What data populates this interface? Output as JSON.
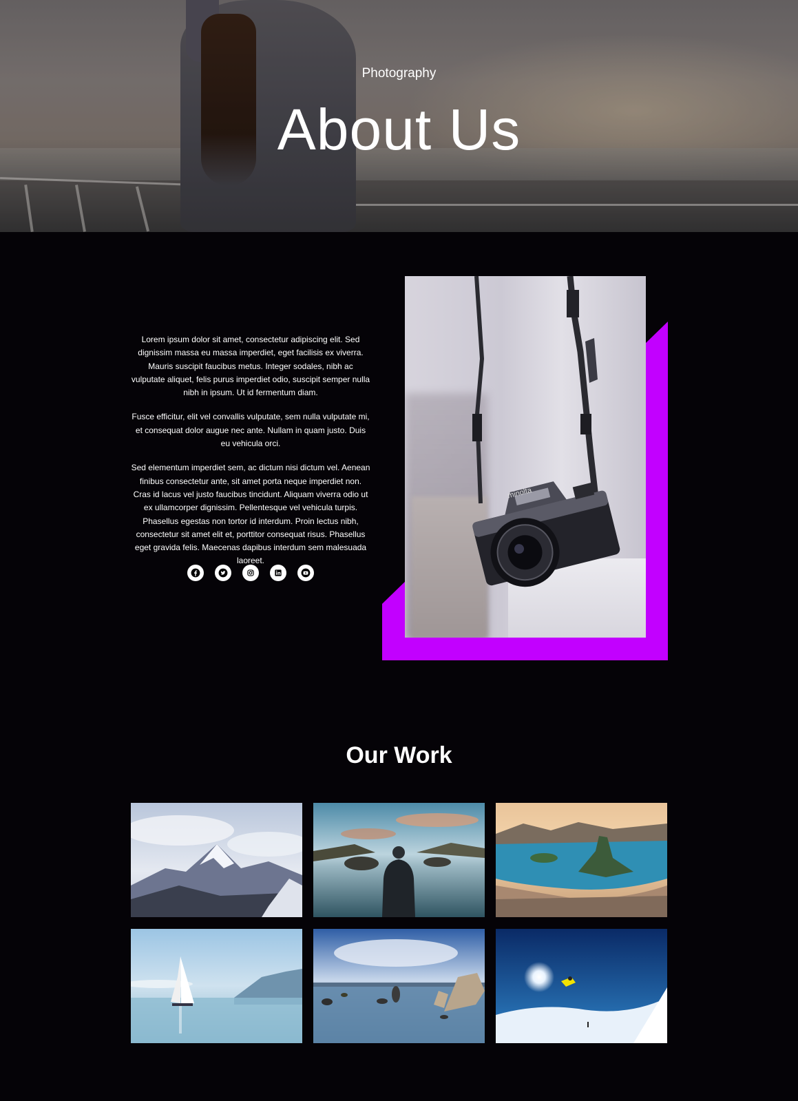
{
  "hero": {
    "subtitle": "Photography",
    "title": "About Us"
  },
  "about": {
    "paragraphs": [
      "Lorem ipsum dolor sit amet, consectetur adipiscing elit. Sed dignissim massa eu massa imperdiet, eget facilisis ex viverra. Mauris suscipit faucibus metus. Integer sodales, nibh ac vulputate aliquet, felis purus imperdiet odio, suscipit semper nulla nibh in ipsum. Ut id fermentum diam.",
      "Fusce efficitur, elit vel convallis vulputate, sem nulla vulputate mi, et consequat dolor augue nec ante. Nullam in quam justo. Duis eu vehicula orci.",
      "Sed elementum imperdiet sem, ac dictum nisi dictum vel. Aenean finibus consectetur ante, sit amet porta neque imperdiet non. Cras id lacus vel justo faucibus tincidunt. Aliquam viverra odio ut ex ullamcorper dignissim. Pellentesque vel vehicula turpis. Phasellus egestas non tortor id interdum. Proin lectus nibh, consectetur sit amet elit et, porttitor consequat risus. Phasellus eget gravida felis. Maecenas dapibus interdum sem malesuada laoreet."
    ],
    "socials": [
      "facebook-icon",
      "twitter-icon",
      "instagram-icon",
      "linkedin-icon",
      "youtube-icon"
    ],
    "camera_brand": "minolta"
  },
  "work": {
    "title": "Our Work",
    "images": [
      "snowy-mountains",
      "man-at-lake",
      "rio-coastline",
      "sailboat-at-sea",
      "rocky-lake",
      "snowboarder-jump"
    ]
  },
  "colors": {
    "background": "#050307",
    "accent": "#c200ff",
    "text": "#ffffff"
  }
}
